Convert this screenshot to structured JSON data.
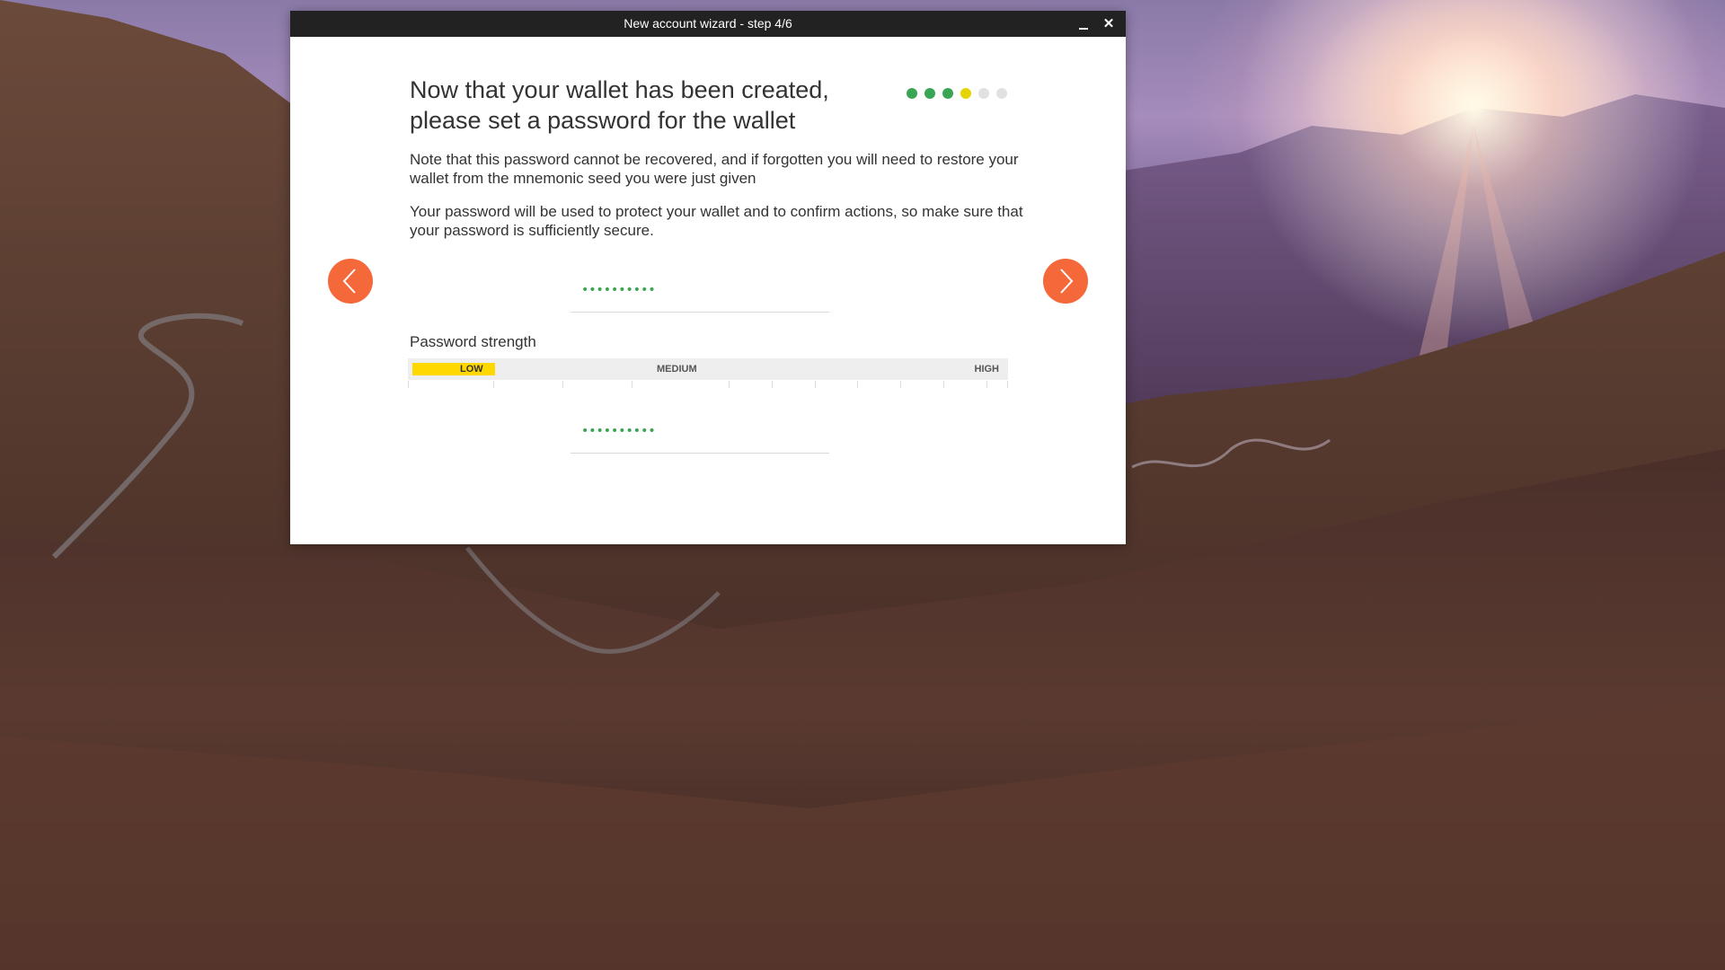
{
  "window": {
    "title": "New account wizard - step 4/6",
    "minimize_label": "_",
    "close_label": "✕"
  },
  "wizard": {
    "heading": "Now that your wallet has been created, please set a password for the wallet",
    "paragraph1": "Note that this password cannot be recovered, and if forgotten you will need to restore your wallet from the mnemonic seed you were just given",
    "paragraph2": "Your password will be used to protect your wallet and to confirm actions, so make sure that your password is sufficiently secure.",
    "current_step": 4,
    "total_steps": 6,
    "prev_icon": "chevron-left-icon",
    "next_icon": "chevron-right-icon"
  },
  "password": {
    "value_masked": "••••••••••",
    "confirm_masked": "••••••••••"
  },
  "strength": {
    "label": "Password strength",
    "low": "LOW",
    "medium": "MEDIUM",
    "high": "HIGH",
    "level_fraction": 0.14
  },
  "colors": {
    "accent_orange": "#f5683a",
    "step_done": "#3aa655",
    "step_current": "#e6d400",
    "step_pending": "#e1e1e1",
    "strength_fill": "#ffd800"
  }
}
